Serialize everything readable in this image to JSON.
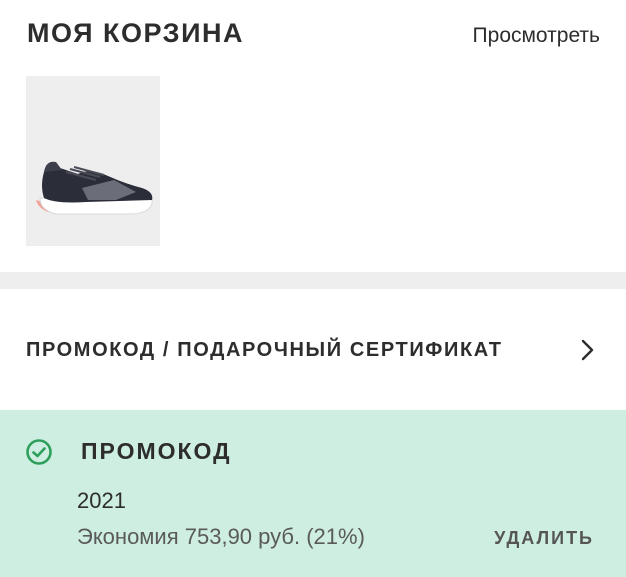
{
  "cart": {
    "title": "МОЯ КОРЗИНА",
    "view_link": "Просмотреть"
  },
  "promo_row": {
    "label": "ПРОМОКОД / ПОДАРОЧНЫЙ СЕРТИФИКАТ",
    "icon": "chevron-right-icon"
  },
  "applied_promo": {
    "heading": "ПРОМОКОД",
    "code": "2021",
    "savings": "Экономия 753,90 руб. (21%)",
    "remove_label": "УДАЛИТЬ",
    "status_icon": "check-circle-icon"
  },
  "colors": {
    "accent_green": "#2e9e5b",
    "promo_background": "#cdeee0",
    "divider": "#eeeeee"
  }
}
